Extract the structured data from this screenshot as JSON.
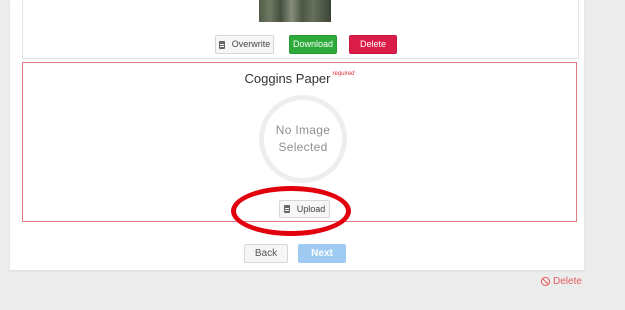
{
  "top_section": {
    "overwrite_label": "Overwrite",
    "download_label": "Download",
    "delete_label": "Delete"
  },
  "coggins": {
    "title": "Coggins Paper",
    "required_label": "required",
    "placeholder_text": "No Image Selected",
    "upload_label": "Upload"
  },
  "nav": {
    "back_label": "Back",
    "next_label": "Next"
  },
  "footer": {
    "delete_label": "Delete"
  },
  "icons": {
    "file": "file-icon",
    "ban": "ban-icon"
  },
  "colors": {
    "download": "#2eaa3a",
    "delete": "#dc1d49",
    "next": "#9fcaf2",
    "required_border": "#e07a84",
    "highlight_ring": "#e1000c",
    "footer_delete": "#e35b5b"
  }
}
